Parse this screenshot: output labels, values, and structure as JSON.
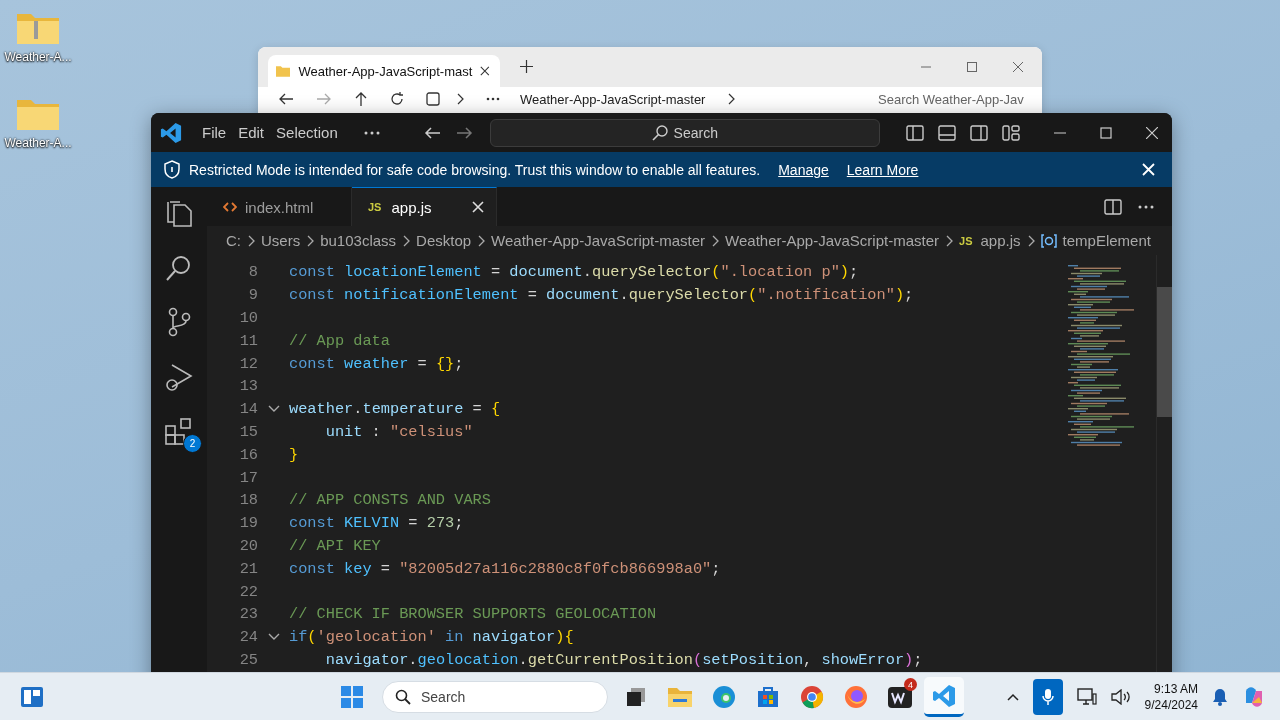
{
  "desktop_icons": [
    {
      "label": "Weather-A...",
      "kind": "zip"
    },
    {
      "label": "Weather-A...",
      "kind": "folder"
    }
  ],
  "explorer_window": {
    "tab_title": "Weather-App-JavaScript-mast",
    "path": "Weather-App-JavaScript-master",
    "search": {
      "placeholder": "Search Weather-App-Jav"
    }
  },
  "editor_window": {
    "menu": [
      "File",
      "Edit",
      "Selection"
    ],
    "search": {
      "placeholder": "Search"
    },
    "banner": {
      "message": "Restricted Mode is intended for safe code browsing. Trust this window to enable all features.",
      "links": [
        "Manage",
        "Learn More"
      ]
    },
    "activity_bar": [
      {
        "kind": "explorer"
      },
      {
        "kind": "search"
      },
      {
        "kind": "source-control"
      },
      {
        "kind": "run"
      },
      {
        "kind": "extensions",
        "badge": "2"
      }
    ],
    "tabs": [
      {
        "label": "index.html",
        "kind": "html",
        "selected": false
      },
      {
        "label": "app.js",
        "kind": "js",
        "icon_text": "JS",
        "selected": true
      }
    ],
    "breadcrumb": [
      {
        "label": "C:"
      },
      {
        "label": "Users"
      },
      {
        "label": "bu103class"
      },
      {
        "label": "Desktop"
      },
      {
        "label": "Weather-App-JavaScript-master"
      },
      {
        "label": "Weather-App-JavaScript-master"
      },
      {
        "label": "app.js",
        "icon_text": "JS"
      },
      {
        "label": "tempElement",
        "kind": "symbol"
      }
    ],
    "code_lines": [
      {
        "number": "8",
        "foldable": false,
        "tokens": [
          {
            "kind": "keyword",
            "text": "const "
          },
          {
            "kind": "constant",
            "text": "locationElement"
          },
          {
            "kind": "plain",
            "text": " = "
          },
          {
            "kind": "variable",
            "text": "document"
          },
          {
            "kind": "plain",
            "text": "."
          },
          {
            "kind": "function",
            "text": "querySelector"
          },
          {
            "kind": "brace",
            "text": "("
          },
          {
            "kind": "string",
            "text": "\".location p\""
          },
          {
            "kind": "brace",
            "text": ")"
          },
          {
            "kind": "plain",
            "text": ";"
          }
        ]
      },
      {
        "number": "9",
        "foldable": false,
        "tokens": [
          {
            "kind": "keyword",
            "text": "const "
          },
          {
            "kind": "constant",
            "text": "notificationElement"
          },
          {
            "kind": "plain",
            "text": " = "
          },
          {
            "kind": "variable",
            "text": "document"
          },
          {
            "kind": "plain",
            "text": "."
          },
          {
            "kind": "function",
            "text": "querySelector"
          },
          {
            "kind": "brace",
            "text": "("
          },
          {
            "kind": "string",
            "text": "\".notification\""
          },
          {
            "kind": "brace",
            "text": ")"
          },
          {
            "kind": "plain",
            "text": ";"
          }
        ]
      },
      {
        "number": "10",
        "foldable": false
      },
      {
        "number": "11",
        "foldable": false,
        "tokens": [
          {
            "kind": "comment",
            "text": "// App data"
          }
        ]
      },
      {
        "number": "12",
        "foldable": false,
        "tokens": [
          {
            "kind": "keyword",
            "text": "const "
          },
          {
            "kind": "constant",
            "text": "weather"
          },
          {
            "kind": "plain",
            "text": " = "
          },
          {
            "kind": "brace",
            "text": "{}"
          },
          {
            "kind": "plain",
            "text": ";"
          }
        ]
      },
      {
        "number": "13",
        "foldable": false
      },
      {
        "number": "14",
        "foldable": true,
        "tokens": [
          {
            "kind": "variable",
            "text": "weather"
          },
          {
            "kind": "plain",
            "text": "."
          },
          {
            "kind": "variable",
            "text": "temperature"
          },
          {
            "kind": "plain",
            "text": " = "
          },
          {
            "kind": "brace",
            "text": "{"
          }
        ]
      },
      {
        "number": "15",
        "foldable": false,
        "tokens": [
          {
            "kind": "variable",
            "text": "    unit"
          },
          {
            "kind": "plain",
            "text": " : "
          },
          {
            "kind": "string",
            "text": "\"celsius\""
          }
        ]
      },
      {
        "number": "16",
        "foldable": false,
        "tokens": [
          {
            "kind": "brace",
            "text": "}"
          }
        ]
      },
      {
        "number": "17",
        "foldable": false
      },
      {
        "number": "18",
        "foldable": false,
        "tokens": [
          {
            "kind": "comment",
            "text": "// APP CONSTS AND VARS"
          }
        ]
      },
      {
        "number": "19",
        "foldable": false,
        "tokens": [
          {
            "kind": "keyword",
            "text": "const "
          },
          {
            "kind": "constant",
            "text": "KELVIN"
          },
          {
            "kind": "plain",
            "text": " = "
          },
          {
            "kind": "number",
            "text": "273"
          },
          {
            "kind": "plain",
            "text": ";"
          }
        ]
      },
      {
        "number": "20",
        "foldable": false,
        "tokens": [
          {
            "kind": "comment",
            "text": "// API KEY"
          }
        ]
      },
      {
        "number": "21",
        "foldable": false,
        "tokens": [
          {
            "kind": "keyword",
            "text": "const "
          },
          {
            "kind": "constant",
            "text": "key"
          },
          {
            "kind": "plain",
            "text": " = "
          },
          {
            "kind": "string",
            "text": "\"82005d27a116c2880c8f0fcb866998a0\""
          },
          {
            "kind": "plain",
            "text": ";"
          }
        ]
      },
      {
        "number": "22",
        "foldable": false
      },
      {
        "number": "23",
        "foldable": false,
        "tokens": [
          {
            "kind": "comment",
            "text": "// CHECK IF BROWSER SUPPORTS GEOLOCATION"
          }
        ]
      },
      {
        "number": "24",
        "foldable": true,
        "tokens": [
          {
            "kind": "keyword",
            "text": "if"
          },
          {
            "kind": "brace",
            "text": "("
          },
          {
            "kind": "string",
            "text": "'geolocation'"
          },
          {
            "kind": "keyword",
            "text": " in "
          },
          {
            "kind": "variable",
            "text": "navigator"
          },
          {
            "kind": "brace",
            "text": ")"
          },
          {
            "kind": "brace",
            "text": "{"
          }
        ]
      },
      {
        "number": "25",
        "foldable": false,
        "tokens": [
          {
            "kind": "variable",
            "text": "    navigator"
          },
          {
            "kind": "plain",
            "text": "."
          },
          {
            "kind": "constant",
            "text": "geolocation"
          },
          {
            "kind": "plain",
            "text": "."
          },
          {
            "kind": "function",
            "text": "getCurrentPosition"
          },
          {
            "kind": "paren",
            "text": "("
          },
          {
            "kind": "variable",
            "text": "setPosition"
          },
          {
            "kind": "plain",
            "text": ", "
          },
          {
            "kind": "variable",
            "text": "showError"
          },
          {
            "kind": "paren",
            "text": ")"
          },
          {
            "kind": "plain",
            "text": ";"
          }
        ]
      }
    ]
  },
  "taskbar": {
    "search": {
      "placeholder": "Search"
    },
    "apps": [
      {
        "kind": "task-view",
        "selected": false
      },
      {
        "kind": "files",
        "selected": false
      },
      {
        "kind": "edge",
        "selected": false
      },
      {
        "kind": "store",
        "selected": false
      },
      {
        "kind": "chrome",
        "selected": false
      },
      {
        "kind": "firefox",
        "selected": false
      },
      {
        "kind": "chat",
        "badge": "4",
        "selected": false
      },
      {
        "kind": "vscode",
        "selected": true
      }
    ],
    "time": "9:13 AM",
    "date": "9/24/2024"
  }
}
